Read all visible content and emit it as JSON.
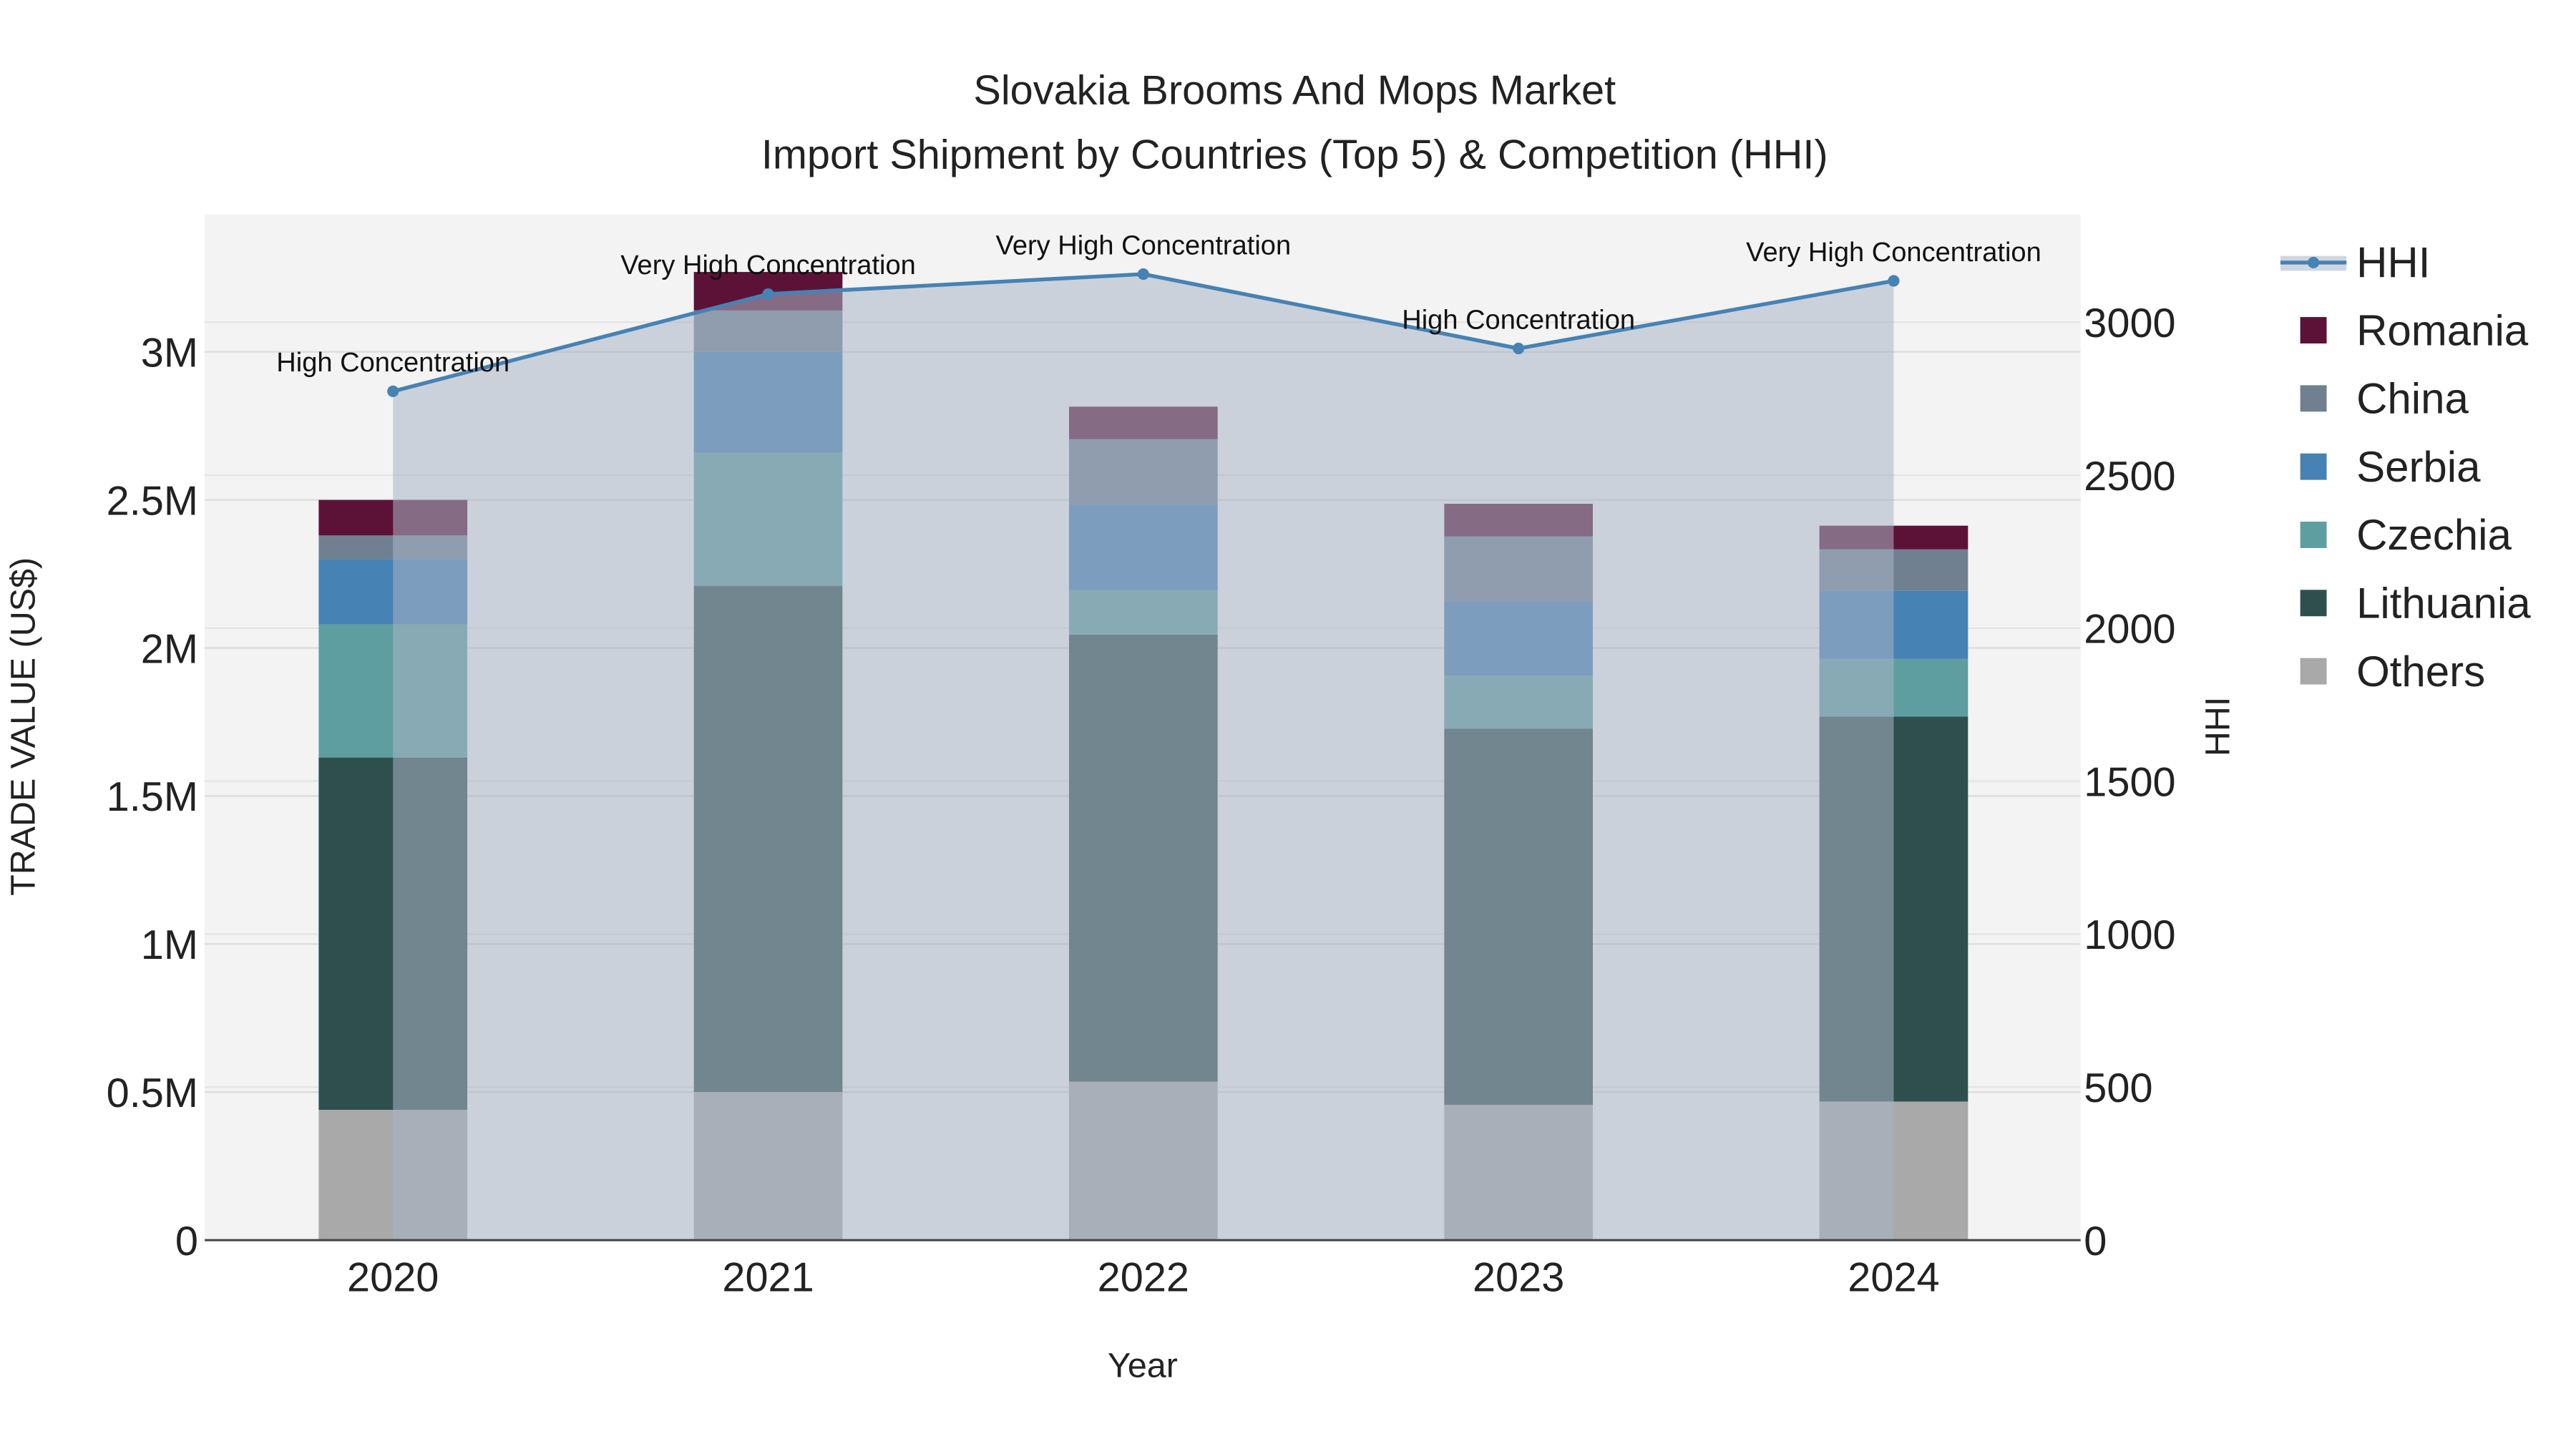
{
  "chart_data": {
    "type": "bar",
    "title": "Slovakia Brooms And Mops Market",
    "subtitle": "Import Shipment by Countries (Top 5) & Competition (HHI)",
    "xlabel": "Year",
    "ylabel": "TRADE VALUE (US$)",
    "y2label": "HHI",
    "categories": [
      "2020",
      "2021",
      "2022",
      "2023",
      "2024"
    ],
    "ylim": [
      0,
      3450000
    ],
    "y2lim": [
      0,
      3350
    ],
    "yticks": [
      0,
      500000,
      1000000,
      1500000,
      2000000,
      2500000,
      3000000
    ],
    "ytick_labels": [
      "0",
      "0.5M",
      "1M",
      "1.5M",
      "2M",
      "2.5M",
      "3M"
    ],
    "y2ticks": [
      0,
      500,
      1000,
      1500,
      2000,
      2500,
      3000
    ],
    "y2tick_labels": [
      "0",
      "500",
      "1000",
      "1500",
      "2000",
      "2500",
      "3000"
    ],
    "stacked": true,
    "series": [
      {
        "name": "Others",
        "color": "#a9a9a9",
        "values": [
          440000,
          500000,
          535000,
          457000,
          468000
        ]
      },
      {
        "name": "Lithuania",
        "color": "#2f4f4f",
        "values": [
          1190000,
          1710000,
          1510000,
          1270000,
          1300000
        ]
      },
      {
        "name": "Czechia",
        "color": "#5f9ea0",
        "values": [
          450000,
          450000,
          150000,
          180000,
          195000
        ]
      },
      {
        "name": "Serbia",
        "color": "#4682b4",
        "values": [
          220000,
          340000,
          290000,
          250000,
          230000
        ]
      },
      {
        "name": "China",
        "color": "#708090",
        "values": [
          80000,
          140000,
          220000,
          220000,
          140000
        ]
      },
      {
        "name": "Romania",
        "color": "#5c1236",
        "values": [
          120000,
          130000,
          110000,
          110000,
          80000
        ]
      }
    ],
    "hhi": {
      "name": "HHI",
      "color": "#4682b4",
      "values": [
        2774,
        3092,
        3157,
        2914,
        3135
      ],
      "annotations": [
        "High Concentration",
        "Very High Concentration",
        "Very High Concentration",
        "High Concentration",
        "Very High Concentration"
      ]
    },
    "legend": [
      "HHI",
      "Romania",
      "China",
      "Serbia",
      "Czechia",
      "Lithuania",
      "Others"
    ],
    "legend_position": "right",
    "grid": true
  }
}
